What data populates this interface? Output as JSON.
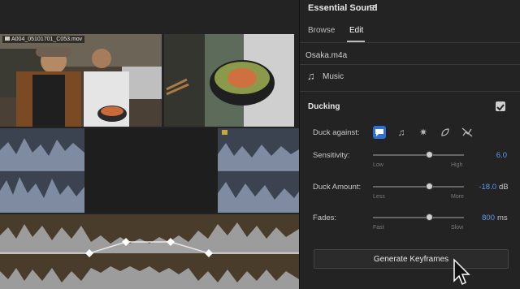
{
  "timeline": {
    "clip_name": "A004_05101701_C053.mov"
  },
  "panel": {
    "title": "Essential Sound",
    "tabs": [
      {
        "label": "Browse"
      },
      {
        "label": "Edit"
      }
    ],
    "file_name": "Osaka.m4a",
    "type_label": "Music",
    "ducking": {
      "title": "Ducking",
      "checked": true,
      "duck_against_label": "Duck against:",
      "sensitivity": {
        "label": "Sensitivity:",
        "value": "6.0",
        "unit": "",
        "low": "Low",
        "high": "High",
        "fraction": 0.62
      },
      "duck_amount": {
        "label": "Duck Amount:",
        "value": "-18.0",
        "unit": "dB",
        "low": "Less",
        "high": "More",
        "fraction": 0.62
      },
      "fades": {
        "label": "Fades:",
        "value": "800",
        "unit": "ms",
        "low": "Fast",
        "high": "Slow",
        "fraction": 0.62
      }
    },
    "generate_button": "Generate Keyframes"
  }
}
